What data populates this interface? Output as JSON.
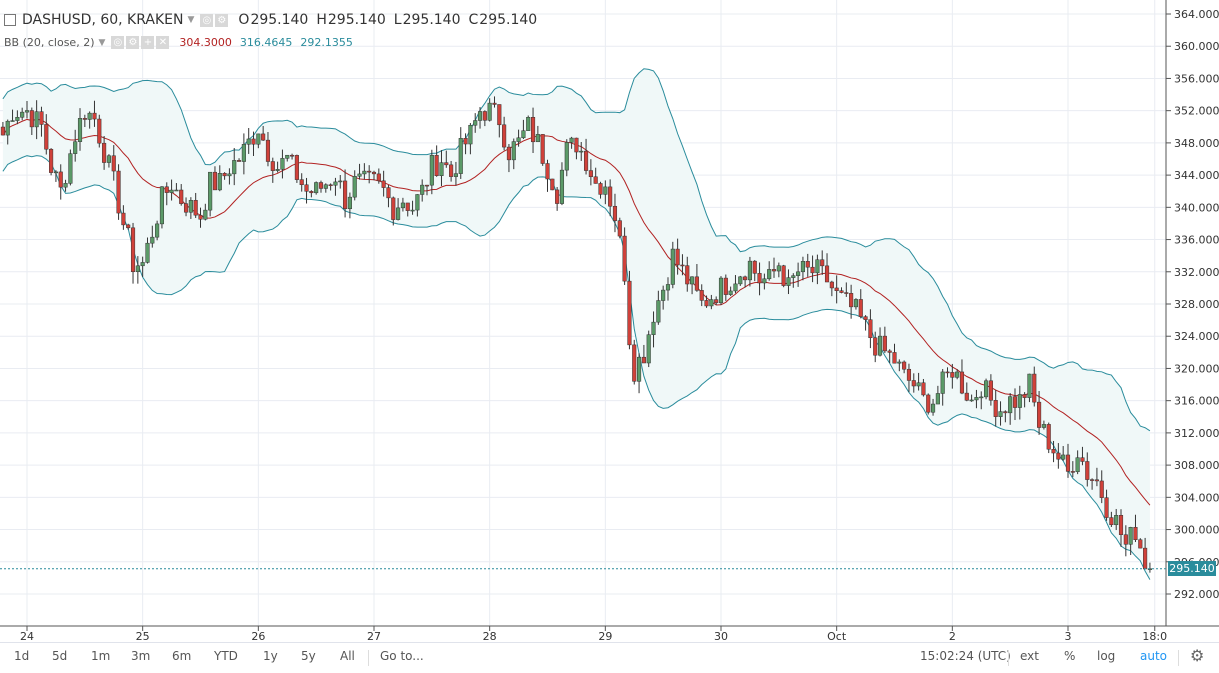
{
  "header": {
    "symbol": "DASHUSD, 60, KRAKEN",
    "ohlc": [
      {
        "label": "O",
        "value": "295.140"
      },
      {
        "label": "H",
        "value": "295.140"
      },
      {
        "label": "L",
        "value": "295.140"
      },
      {
        "label": "C",
        "value": "295.140"
      }
    ]
  },
  "indicator": {
    "name": "BB (20, close, 2)",
    "middle": "304.3000",
    "upper": "316.4645",
    "lower": "292.1355"
  },
  "last_price": "295.140",
  "colors": {
    "up": "#5b9a68",
    "down": "#d0413a",
    "bb_band": "#2a8c9c",
    "bb_mid": "#b22222",
    "fill": "#f0f8f8"
  },
  "chart_data": {
    "type": "candlestick",
    "ylim": [
      290,
      365
    ],
    "yticks": [
      292,
      296,
      300,
      304,
      308,
      312,
      316,
      320,
      324,
      328,
      332,
      336,
      340,
      344,
      348,
      352,
      356,
      360,
      364
    ],
    "ytick_labels": [
      "292.000",
      "296.000",
      "300.000",
      "304.000",
      "308.000",
      "312.000",
      "316.000",
      "320.000",
      "324.000",
      "328.000",
      "332.000",
      "336.000",
      "340.000",
      "344.000",
      "348.000",
      "352.000",
      "356.000",
      "360.000",
      "364.000"
    ],
    "x_labels": [
      {
        "label": "24",
        "hour": 0
      },
      {
        "label": "25",
        "hour": 24
      },
      {
        "label": "26",
        "hour": 48
      },
      {
        "label": "27",
        "hour": 72
      },
      {
        "label": "28",
        "hour": 96
      },
      {
        "label": "29",
        "hour": 120
      },
      {
        "label": "30",
        "hour": 144
      },
      {
        "label": "Oct",
        "hour": 168
      },
      {
        "label": "2",
        "hour": 192
      },
      {
        "label": "3",
        "hour": 216
      },
      {
        "label": "18:0",
        "hour": 234
      }
    ],
    "x_start_hour": -5,
    "x_end_hour": 238,
    "close_anchors": [
      [
        -5,
        349
      ],
      [
        -3,
        352
      ],
      [
        0,
        352
      ],
      [
        3,
        350
      ],
      [
        5,
        345
      ],
      [
        7,
        342
      ],
      [
        10,
        349
      ],
      [
        12,
        352
      ],
      [
        14,
        351
      ],
      [
        16,
        347
      ],
      [
        18,
        343
      ],
      [
        20,
        338
      ],
      [
        21,
        336
      ],
      [
        22,
        333
      ],
      [
        24,
        333
      ],
      [
        26,
        337
      ],
      [
        28,
        341
      ],
      [
        30,
        343
      ],
      [
        32,
        341
      ],
      [
        34,
        340
      ],
      [
        36,
        339
      ],
      [
        38,
        343
      ],
      [
        40,
        343
      ],
      [
        42,
        345
      ],
      [
        44,
        346
      ],
      [
        46,
        348
      ],
      [
        48,
        350
      ],
      [
        50,
        347
      ],
      [
        52,
        345
      ],
      [
        54,
        346
      ],
      [
        56,
        344
      ],
      [
        58,
        342
      ],
      [
        60,
        342
      ],
      [
        62,
        343
      ],
      [
        64,
        344
      ],
      [
        66,
        341
      ],
      [
        68,
        343
      ],
      [
        70,
        343
      ],
      [
        72,
        343
      ],
      [
        74,
        342
      ],
      [
        76,
        340
      ],
      [
        78,
        341
      ],
      [
        80,
        340
      ],
      [
        82,
        342
      ],
      [
        84,
        345
      ],
      [
        86,
        346
      ],
      [
        88,
        344
      ],
      [
        90,
        347
      ],
      [
        92,
        349
      ],
      [
        94,
        352
      ],
      [
        96,
        352
      ],
      [
        98,
        351
      ],
      [
        100,
        347
      ],
      [
        102,
        348
      ],
      [
        104,
        350
      ],
      [
        106,
        348
      ],
      [
        108,
        345
      ],
      [
        110,
        342
      ],
      [
        112,
        347
      ],
      [
        114,
        348
      ],
      [
        116,
        346
      ],
      [
        118,
        343
      ],
      [
        120,
        343
      ],
      [
        122,
        339
      ],
      [
        124,
        332
      ],
      [
        125,
        324
      ],
      [
        126,
        320
      ],
      [
        128,
        322
      ],
      [
        130,
        327
      ],
      [
        132,
        330
      ],
      [
        134,
        334
      ],
      [
        136,
        332
      ],
      [
        138,
        330
      ],
      [
        140,
        328
      ],
      [
        142,
        329
      ],
      [
        144,
        330
      ],
      [
        146,
        331
      ],
      [
        148,
        332
      ],
      [
        150,
        333
      ],
      [
        152,
        331
      ],
      [
        154,
        331
      ],
      [
        156,
        333
      ],
      [
        158,
        330
      ],
      [
        160,
        332
      ],
      [
        162,
        332
      ],
      [
        164,
        332
      ],
      [
        166,
        331
      ],
      [
        168,
        329
      ],
      [
        170,
        328
      ],
      [
        172,
        327
      ],
      [
        174,
        325
      ],
      [
        176,
        323
      ],
      [
        178,
        322
      ],
      [
        180,
        321
      ],
      [
        182,
        319
      ],
      [
        184,
        318
      ],
      [
        186,
        316
      ],
      [
        188,
        316
      ],
      [
        190,
        318
      ],
      [
        192,
        320
      ],
      [
        194,
        318
      ],
      [
        196,
        316
      ],
      [
        198,
        318
      ],
      [
        200,
        316
      ],
      [
        202,
        315
      ],
      [
        204,
        316
      ],
      [
        206,
        316
      ],
      [
        208,
        318
      ],
      [
        210,
        313
      ],
      [
        212,
        311
      ],
      [
        214,
        309
      ],
      [
        216,
        307
      ],
      [
        218,
        310
      ],
      [
        220,
        307
      ],
      [
        222,
        306
      ],
      [
        224,
        303
      ],
      [
        226,
        301
      ],
      [
        228,
        298
      ],
      [
        230,
        300
      ],
      [
        232,
        296
      ],
      [
        233,
        295.14
      ]
    ],
    "bollinger": {
      "period": 20,
      "stddev": 2,
      "last_middle": 304.3,
      "last_upper": 316.4645,
      "last_lower": 292.1355
    }
  },
  "toolbar": {
    "timeframes": [
      "1d",
      "5d",
      "1m",
      "3m",
      "6m",
      "YTD",
      "1y",
      "5y",
      "All"
    ],
    "goto": "Go to...",
    "time": "15:02:24 (UTC)",
    "options": [
      "ext",
      "%",
      "log",
      "auto"
    ]
  }
}
